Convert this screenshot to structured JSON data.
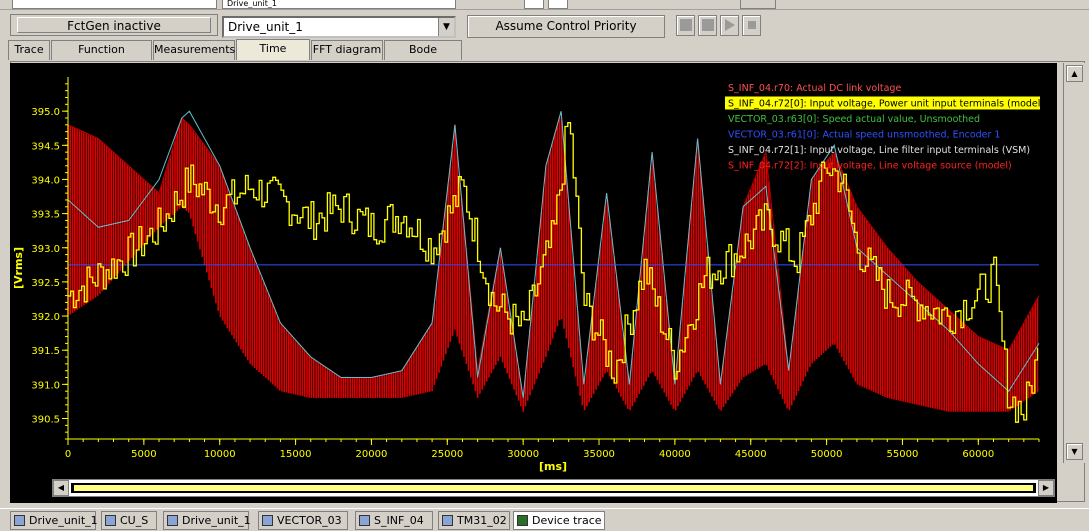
{
  "toolbar": {
    "fctgen_label": "FctGen  inactive",
    "drive_select_value": "Drive_unit_1",
    "assume_button": "Assume Control Priority",
    "top_stub_text": "Drive_unit_1"
  },
  "tabs": [
    {
      "label": "Trace"
    },
    {
      "label": "Function generator"
    },
    {
      "label": "Measurements"
    },
    {
      "label": "Time diagram",
      "active": true
    },
    {
      "label": "FFT diagram"
    },
    {
      "label": "Bode diagram"
    }
  ],
  "taskbar": [
    {
      "label": "Drive_unit_1"
    },
    {
      "label": "CU_S"
    },
    {
      "label": "Drive_unit_1"
    },
    {
      "label": "VECTOR_03"
    },
    {
      "label": "S_INF_04"
    },
    {
      "label": "TM31_02"
    },
    {
      "label": "Device trace",
      "active": true
    }
  ],
  "colors": {
    "plot_bg": "#000000",
    "axis_text": "#ffff00",
    "grid": "#505050",
    "red": "#e00000",
    "yellow": "#ffff00",
    "cyan": "#60c0d0",
    "blue": "#3050ff",
    "green": "#40c040",
    "white": "#ffffff"
  },
  "chart_data": {
    "type": "line",
    "xlabel": "[ms]",
    "ylabel": "[Vrms]",
    "xlim": [
      0,
      64000
    ],
    "ylim": [
      390.2,
      395.5
    ],
    "x_ticks": [
      0,
      5000,
      10000,
      15000,
      20000,
      25000,
      30000,
      35000,
      40000,
      45000,
      50000,
      55000,
      60000
    ],
    "y_ticks": [
      "395.0",
      "394.5",
      "394.0",
      "393.5",
      "393.0",
      "392.5",
      "392.0",
      "391.5",
      "391.0",
      "390.5"
    ],
    "y_tick_values": [
      395.0,
      394.5,
      394.0,
      393.5,
      393.0,
      392.5,
      392.0,
      391.5,
      391.0,
      390.5
    ],
    "grid": false,
    "legend_position": "top-right",
    "legend": [
      {
        "text": "S_INF_04.r70: Actual DC link voltage",
        "color": "#ff5050"
      },
      {
        "text": "S_INF_04.r72[0]: Input voltage, Power unit input terminals (model)",
        "color": "#000000",
        "highlight": "#ffff00"
      },
      {
        "text": "VECTOR_03.r63[0]: Speed actual value, Unsmoothed",
        "color": "#40c040"
      },
      {
        "text": "VECTOR_03.r61[0]: Actual speed unsmoothed, Encoder 1",
        "color": "#3050ff"
      },
      {
        "text": "S_INF_04.r72[1]: Input voltage, Line filter input terminals (VSM)",
        "color": "#e0e0e0"
      },
      {
        "text": "S_INF_04.r72[2]: Input voltage, Line voltage source (model)",
        "color": "#ff2020"
      }
    ],
    "series": [
      {
        "color": "#ffff00",
        "x": [
          0,
          2000,
          4000,
          6000,
          8000,
          10000,
          12000,
          14000,
          16000,
          18000,
          20000,
          22000,
          24000,
          26000,
          28000,
          30000,
          32000,
          33000,
          34000,
          36000,
          38000,
          40000,
          42000,
          44000,
          46000,
          48000,
          50000,
          51000,
          52000,
          54000,
          56000,
          58000,
          60000,
          61000,
          62000,
          63000,
          64000
        ],
        "y": [
          392.3,
          392.6,
          392.9,
          393.3,
          394.0,
          393.6,
          393.9,
          393.7,
          393.4,
          393.6,
          393.3,
          393.5,
          393.0,
          393.9,
          392.2,
          391.8,
          393.2,
          394.9,
          392.2,
          391.2,
          392.7,
          391.3,
          392.6,
          392.9,
          393.4,
          392.8,
          394.2,
          394.0,
          393.0,
          392.3,
          392.2,
          392.0,
          392.3,
          392.6,
          390.8,
          390.6,
          391.5
        ]
      },
      {
        "color": "#60c0d0",
        "x": [
          0,
          2000,
          4000,
          6000,
          7500,
          8000,
          10000,
          12000,
          14000,
          16000,
          18000,
          20000,
          22000,
          24000,
          25500,
          27000,
          28500,
          30000,
          31500,
          32500,
          34000,
          35500,
          37000,
          38500,
          40000,
          41500,
          43000,
          44500,
          46000,
          47500,
          49000,
          50500,
          52000,
          54000,
          56000,
          58000,
          60000,
          62000,
          64000
        ],
        "y": [
          393.7,
          393.3,
          393.4,
          394.0,
          394.9,
          395.0,
          394.2,
          393.0,
          391.9,
          391.4,
          391.1,
          391.1,
          391.2,
          391.9,
          394.8,
          391.1,
          393.0,
          390.8,
          394.2,
          395.0,
          391.0,
          393.8,
          391.0,
          394.4,
          391.0,
          394.6,
          391.0,
          393.6,
          393.9,
          391.2,
          394.0,
          394.5,
          393.0,
          392.6,
          392.2,
          391.8,
          391.3,
          390.9,
          391.6
        ]
      },
      {
        "color": "#3050ff",
        "x": [
          0,
          64000
        ],
        "y": [
          392.75,
          392.75
        ]
      },
      {
        "color": "#e00000",
        "x": [
          0,
          2000,
          4000,
          6000,
          7500,
          8000,
          10000,
          12000,
          14000,
          16000,
          18000,
          20000,
          22000,
          24000,
          25500,
          27000,
          28500,
          30000,
          31500,
          32500,
          34000,
          35500,
          37000,
          38500,
          40000,
          41500,
          43000,
          44500,
          46000,
          47500,
          49000,
          50500,
          52000,
          54000,
          56000,
          58000,
          60000,
          62000,
          64000
        ],
        "y_high": [
          394.8,
          394.6,
          394.2,
          393.8,
          394.9,
          394.8,
          394.2,
          393.0,
          391.9,
          391.4,
          391.1,
          391.1,
          391.2,
          391.9,
          394.8,
          391.2,
          393.0,
          390.8,
          394.2,
          395.0,
          391.0,
          393.8,
          391.0,
          394.4,
          391.0,
          394.6,
          391.0,
          393.6,
          394.4,
          391.2,
          394.0,
          394.4,
          393.6,
          393.0,
          392.5,
          392.1,
          391.7,
          391.5,
          392.3
        ],
        "y_low": [
          392.0,
          392.3,
          392.8,
          393.3,
          393.6,
          393.5,
          392.0,
          391.3,
          390.9,
          390.8,
          390.8,
          390.8,
          390.8,
          390.9,
          391.8,
          390.8,
          391.4,
          390.6,
          391.4,
          392.0,
          390.6,
          391.2,
          390.6,
          391.2,
          390.6,
          391.2,
          390.6,
          391.1,
          391.3,
          390.6,
          391.3,
          391.6,
          391.0,
          390.8,
          390.7,
          390.6,
          390.6,
          390.6,
          390.9
        ]
      }
    ]
  }
}
